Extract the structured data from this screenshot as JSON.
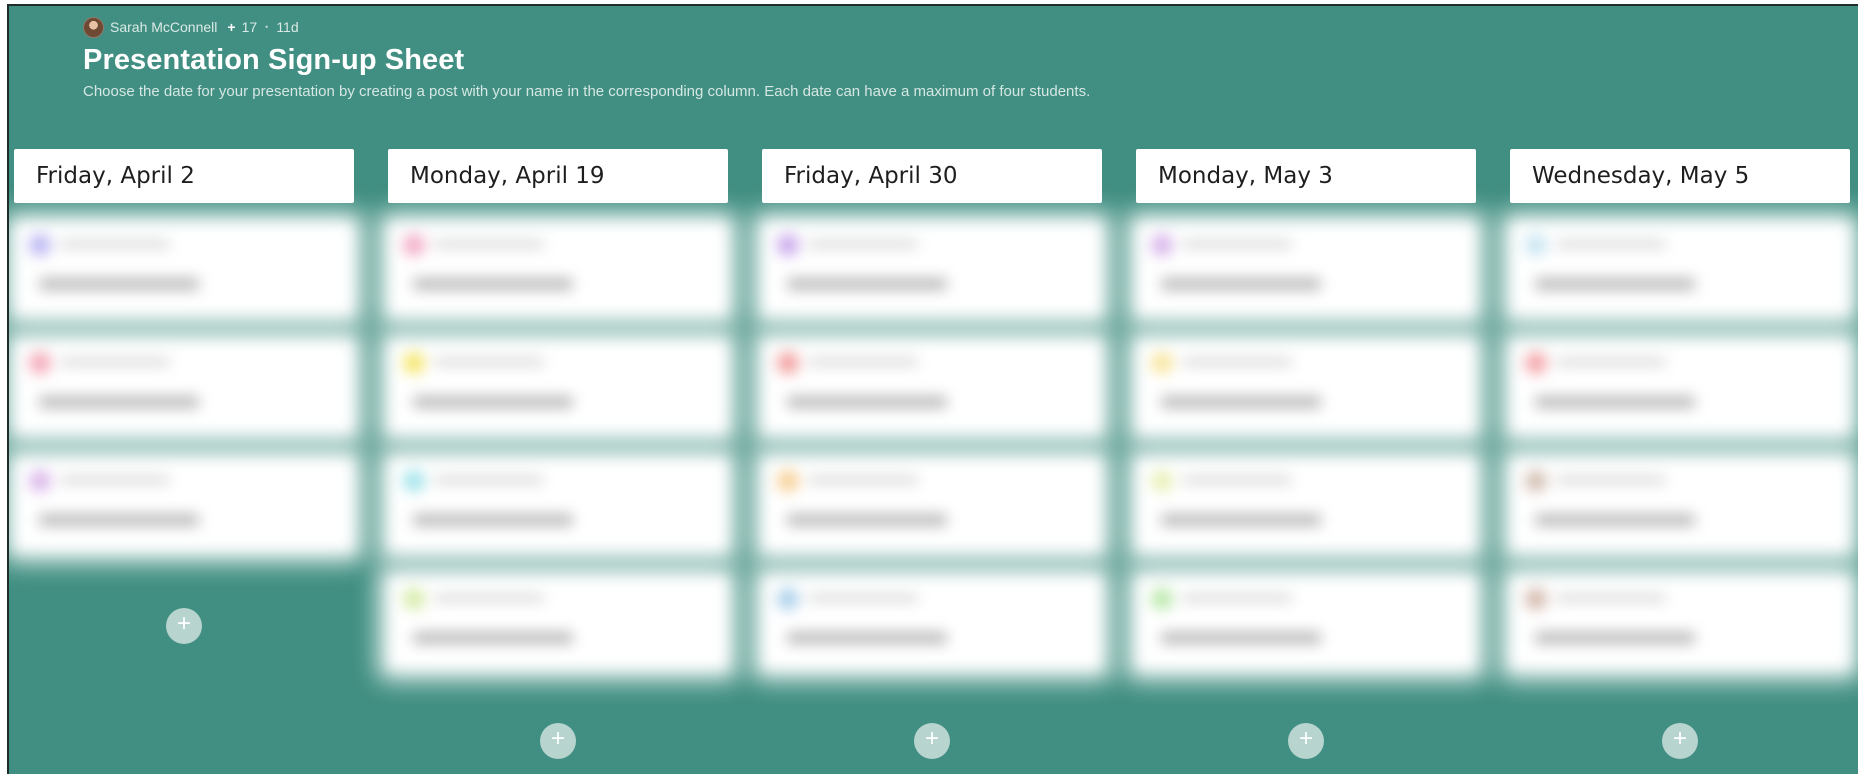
{
  "meta": {
    "author": "Sarah McConnell",
    "plus_label": "+",
    "contributors": "17",
    "separator": "•",
    "age": "11d"
  },
  "header": {
    "title": "Presentation Sign-up Sheet",
    "description": "Choose the date for your presentation by creating a post with your name in the corresponding column. Each date can have a maximum of four students."
  },
  "columns": [
    {
      "title": "Friday, April 2",
      "posts": [
        {
          "avatar_color": "#b9b4f2"
        },
        {
          "avatar_color": "#f3a5b5"
        },
        {
          "avatar_color": "#d9b5ea"
        }
      ],
      "add_label": "+"
    },
    {
      "title": "Monday, April 19",
      "posts": [
        {
          "avatar_color": "#f2a9c4"
        },
        {
          "avatar_color": "#f5e66a"
        },
        {
          "avatar_color": "#9fe3ea"
        },
        {
          "avatar_color": "#d5eba6"
        }
      ],
      "add_label": "+"
    },
    {
      "title": "Friday, April 30",
      "posts": [
        {
          "avatar_color": "#c8a6ec"
        },
        {
          "avatar_color": "#f39c9c"
        },
        {
          "avatar_color": "#f7cf94"
        },
        {
          "avatar_color": "#a8cfea"
        }
      ],
      "add_label": "+"
    },
    {
      "title": "Monday, May 3",
      "posts": [
        {
          "avatar_color": "#d6b2ea"
        },
        {
          "avatar_color": "#f7e59a"
        },
        {
          "avatar_color": "#e8f0b4"
        },
        {
          "avatar_color": "#b8e8a9"
        }
      ],
      "add_label": "+"
    },
    {
      "title": "Wednesday, May 5",
      "posts": [
        {
          "avatar_color": "#c6e4f1"
        },
        {
          "avatar_color": "#f3a1a6"
        },
        {
          "avatar_color": "#d2bdb0"
        },
        {
          "avatar_color": "#d4b8ac"
        }
      ],
      "add_label": "+"
    }
  ]
}
